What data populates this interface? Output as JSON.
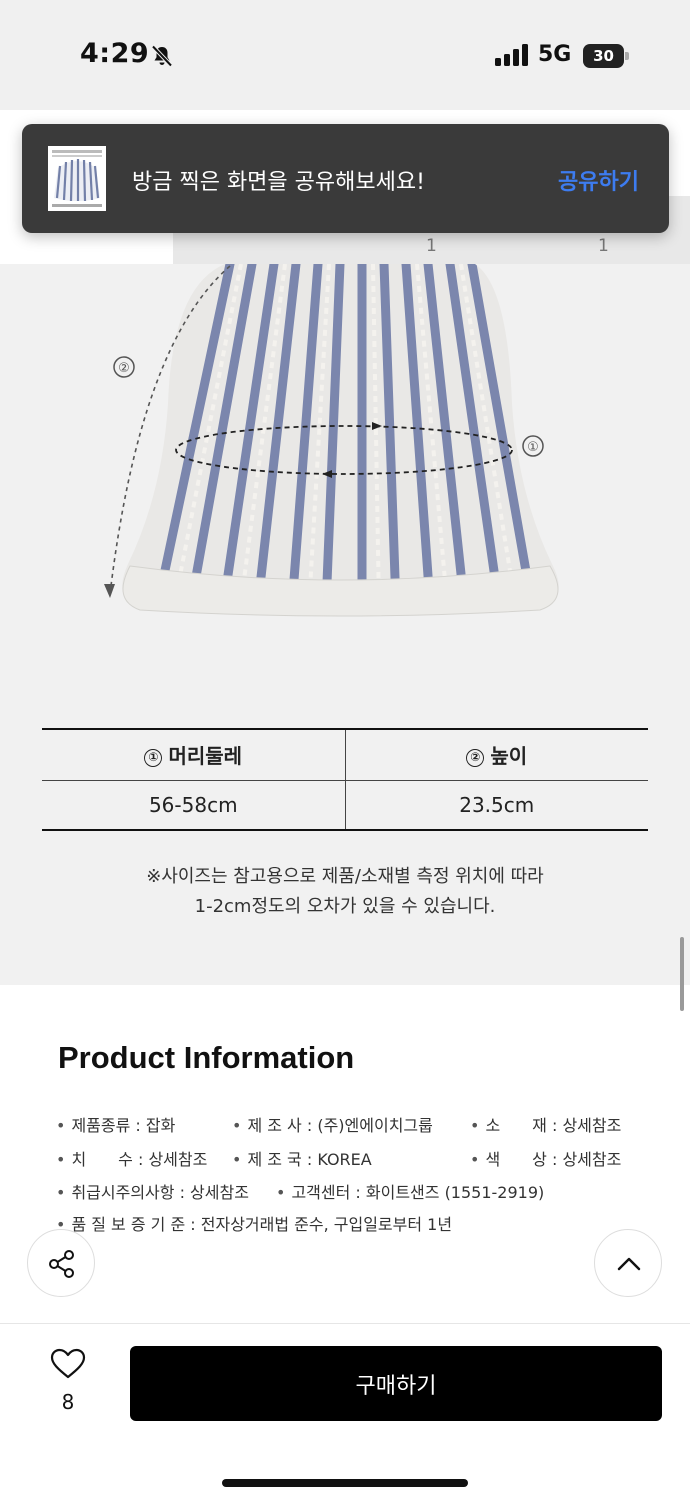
{
  "status_bar": {
    "time": "4:29",
    "network": "5G",
    "battery": "30"
  },
  "tabs": {
    "counts": [
      "1",
      "1"
    ]
  },
  "toast": {
    "message": "방금 찍은 화면을 공유해보세요!",
    "action": "공유하기"
  },
  "size_chart": {
    "diagram_labels": [
      "①",
      "②"
    ],
    "header_1_num": "①",
    "header_1": "머리둘레",
    "header_2_num": "②",
    "header_2": "높이",
    "value_1": "56-58cm",
    "value_2": "23.5cm",
    "note_line_1": "※사이즈는 참고용으로 제품/소재별 측정 위치에 따라",
    "note_line_2": "1-2cm정도의 오차가 있을 수 있습니다."
  },
  "product_info": {
    "title": "Product Information",
    "rows": [
      [
        "제품종류 : 잡화",
        "제 조 사 : (주)엔에이치그룹",
        "소　　재 : 상세참조"
      ],
      [
        "치　　수 : 상세참조",
        "제 조 국 : KOREA",
        "색　　상 : 상세참조"
      ],
      [
        "취급시주의사항 : 상세참조",
        "고객센터 : 화이트샌즈 (1551-2919)"
      ],
      [
        "품 질 보 증 기 준 : 전자상거래법 준수, 구입일로부터 1년"
      ]
    ]
  },
  "icons": {
    "share": "share-icon",
    "scroll_top": "chevron-up-icon",
    "like": "heart-icon"
  },
  "bottom_bar": {
    "like_count": "8",
    "buy_label": "구매하기"
  }
}
